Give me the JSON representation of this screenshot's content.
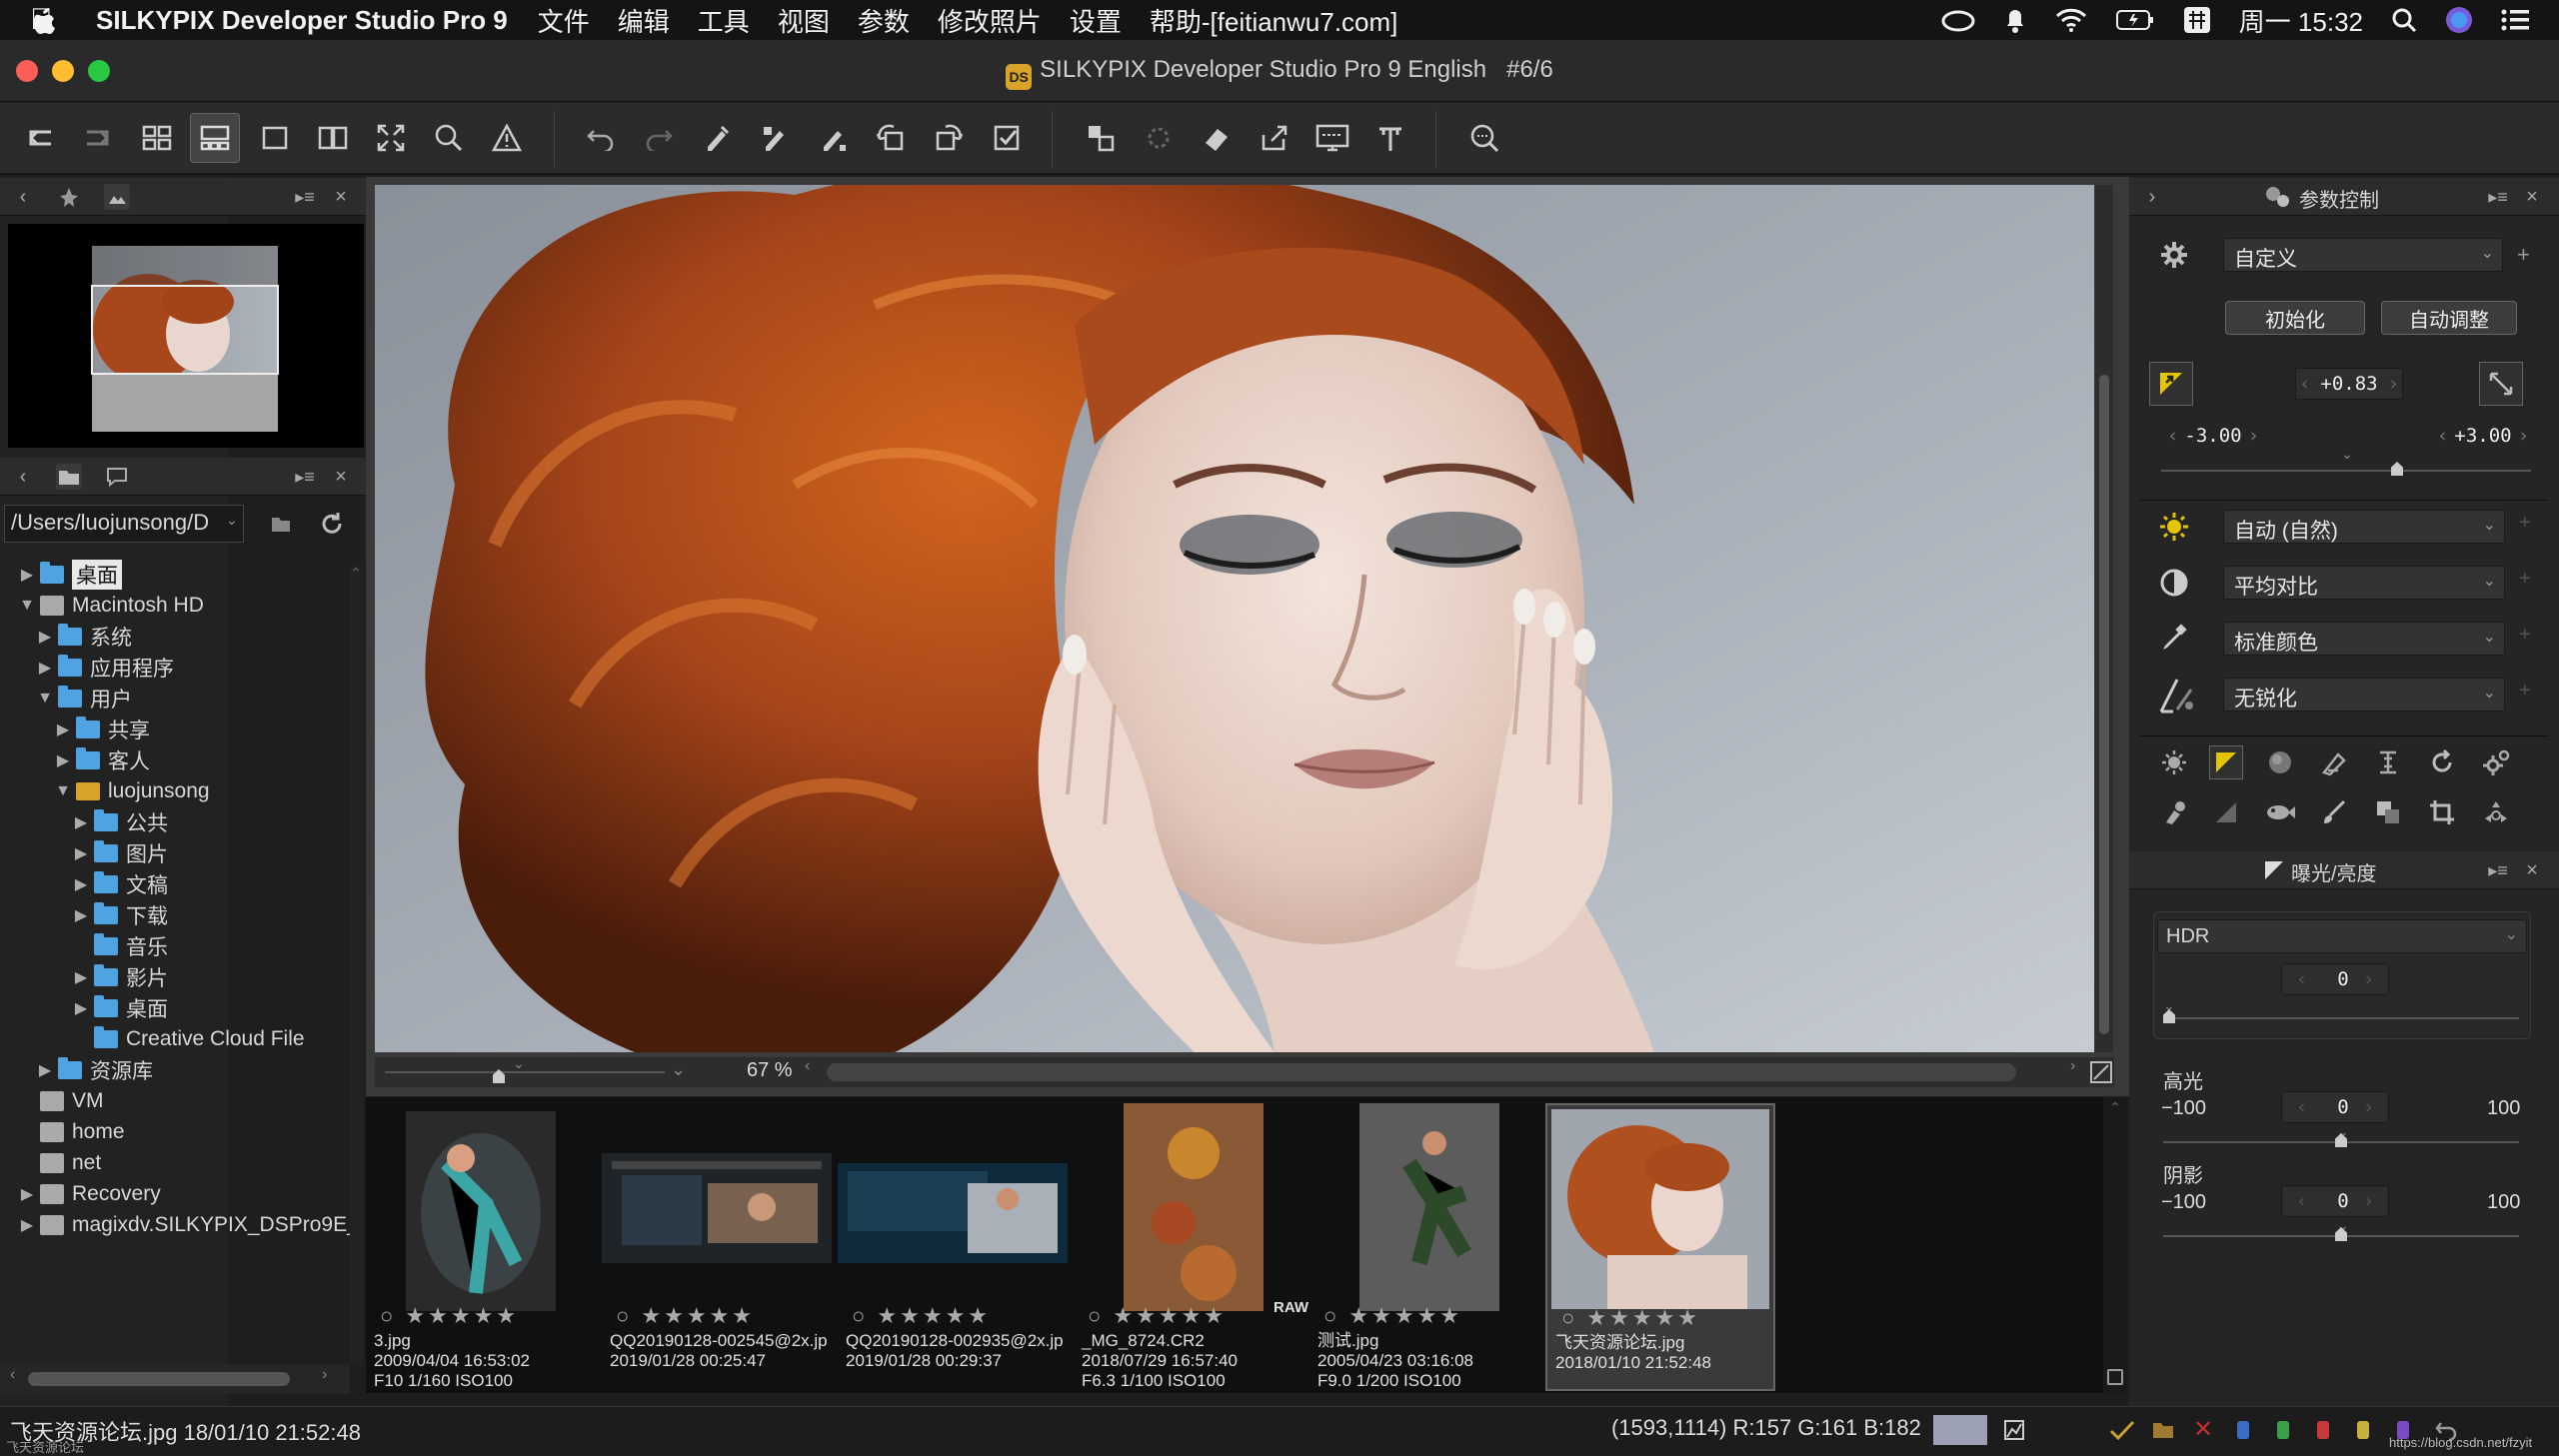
{
  "menubar": {
    "app_name": "SILKYPIX Developer Studio Pro 9",
    "items": [
      "文件",
      "编辑",
      "工具",
      "视图",
      "参数",
      "修改照片",
      "设置",
      "帮助-[feitianwu7.com]"
    ],
    "clock": "周一 15:32"
  },
  "window": {
    "title": "SILKYPIX Developer Studio Pro 9 English",
    "counter": "#6/6",
    "logo_text": "DS"
  },
  "browser": {
    "path": "/Users/luojunsong/D",
    "tree": [
      {
        "label": "桌面",
        "indent": 0,
        "arrow": "▶",
        "icon": "blue",
        "selected": true
      },
      {
        "label": "Macintosh HD",
        "indent": 0,
        "arrow": "▼",
        "icon": "disk"
      },
      {
        "label": "系统",
        "indent": 1,
        "arrow": "▶",
        "icon": "blue"
      },
      {
        "label": "应用程序",
        "indent": 1,
        "arrow": "▶",
        "icon": "blue"
      },
      {
        "label": "用户",
        "indent": 1,
        "arrow": "▼",
        "icon": "blue"
      },
      {
        "label": "共享",
        "indent": 2,
        "arrow": "▶",
        "icon": "blue"
      },
      {
        "label": "客人",
        "indent": 2,
        "arrow": "▶",
        "icon": "blue"
      },
      {
        "label": "luojunsong",
        "indent": 2,
        "arrow": "▼",
        "icon": "home"
      },
      {
        "label": "公共",
        "indent": 3,
        "arrow": "▶",
        "icon": "blue"
      },
      {
        "label": "图片",
        "indent": 3,
        "arrow": "▶",
        "icon": "blue"
      },
      {
        "label": "文稿",
        "indent": 3,
        "arrow": "▶",
        "icon": "blue"
      },
      {
        "label": "下载",
        "indent": 3,
        "arrow": "▶",
        "icon": "blue"
      },
      {
        "label": "音乐",
        "indent": 3,
        "arrow": "",
        "icon": "blue"
      },
      {
        "label": "影片",
        "indent": 3,
        "arrow": "▶",
        "icon": "blue"
      },
      {
        "label": "桌面",
        "indent": 3,
        "arrow": "▶",
        "icon": "blue"
      },
      {
        "label": "Creative Cloud File",
        "indent": 3,
        "arrow": "",
        "icon": "blue"
      },
      {
        "label": "资源库",
        "indent": 1,
        "arrow": "▶",
        "icon": "blue"
      },
      {
        "label": "VM",
        "indent": 0,
        "arrow": "",
        "icon": "disk"
      },
      {
        "label": "home",
        "indent": 0,
        "arrow": "",
        "icon": "disk"
      },
      {
        "label": "net",
        "indent": 0,
        "arrow": "",
        "icon": "disk"
      },
      {
        "label": "Recovery",
        "indent": 0,
        "arrow": "▶",
        "icon": "disk"
      },
      {
        "label": "magixdv.SILKYPIX_DSPro9E_",
        "indent": 0,
        "arrow": "▶",
        "icon": "disk"
      }
    ]
  },
  "viewer": {
    "zoom": "67 %"
  },
  "filmstrip": [
    {
      "name": "3.jpg",
      "date": "2009/04/04 16:53:02",
      "exif": "F10 1/160 ISO100",
      "raw": ""
    },
    {
      "name": "QQ20190128-002545@2x.jp",
      "date": "2019/01/28 00:25:47",
      "exif": "",
      "raw": ""
    },
    {
      "name": "QQ20190128-002935@2x.jp",
      "date": "2019/01/28 00:29:37",
      "exif": "",
      "raw": ""
    },
    {
      "name": "_MG_8724.CR2",
      "date": "2018/07/29 16:57:40",
      "exif": "F6.3 1/100 ISO100",
      "raw": "RAW"
    },
    {
      "name": "测试.jpg",
      "date": "2005/04/23 03:16:08",
      "exif": "F9.0 1/200 ISO100",
      "raw": ""
    },
    {
      "name": "飞天资源论坛.jpg",
      "date": "2018/01/10 21:52:48",
      "exif": "",
      "raw": ""
    }
  ],
  "params": {
    "header": "参数控制",
    "preset": "自定义",
    "init_button": "初始化",
    "auto_button": "自动调整",
    "exposure_value": "+0.83",
    "exposure_min": "-3.00",
    "exposure_max": "+3.00",
    "white_balance": "自动 (自然)",
    "contrast": "平均对比",
    "color": "标准颜色",
    "sharpness": "无锐化"
  },
  "exposure_panel": {
    "header": "曝光/亮度",
    "hdr_label": "HDR",
    "hdr_value": "0",
    "highlight_label": "高光",
    "highlight_min": "−100",
    "highlight_value": "0",
    "highlight_max": "100",
    "shadow_label": "阴影",
    "shadow_min": "−100",
    "shadow_value": "0",
    "shadow_max": "100"
  },
  "status": {
    "file_info": "飞天资源论坛.jpg 18/01/10 21:52:48",
    "pixel_info": "(1593,1114) R:157 G:161 B:182",
    "watermark_left": "飞天资源论坛",
    "watermark_right": "https://blog.csdn.net/fzyit"
  }
}
